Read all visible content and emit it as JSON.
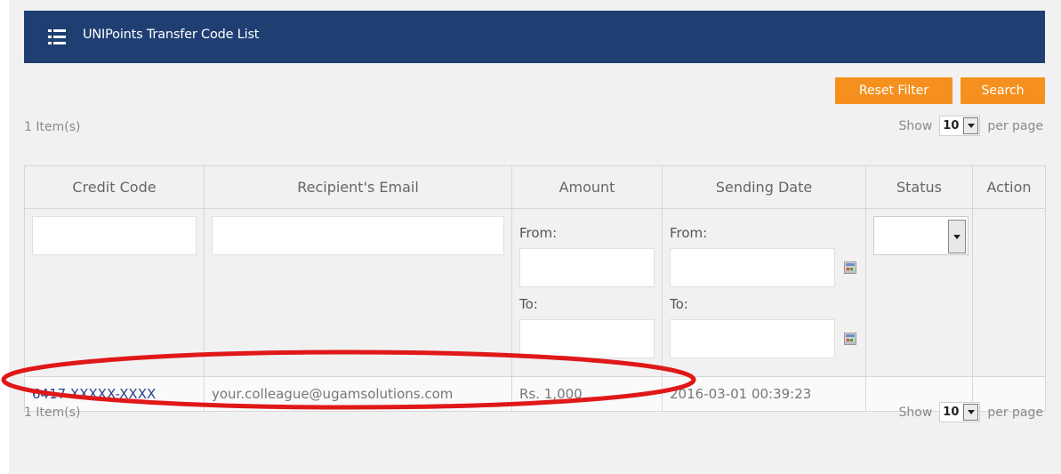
{
  "header": {
    "title": "UNIPoints Transfer Code List",
    "icon": "list-icon"
  },
  "toolbar": {
    "reset_label": "Reset Filter",
    "search_label": "Search",
    "accent": "#f5901e"
  },
  "pagination_top": {
    "count": "1 Item(s)",
    "show": "Show",
    "page_size": "10",
    "per_page": "per page"
  },
  "pagination_bottom": {
    "count": "1 Item(s)",
    "show": "Show",
    "page_size": "10",
    "per_page": "per page"
  },
  "table": {
    "columns": [
      "Credit Code",
      "Recipient's Email",
      "Amount",
      "Sending Date",
      "Status",
      "Action"
    ],
    "filters": {
      "amount_from": "From:",
      "amount_to": "To:",
      "date_from": "From:",
      "date_to": "To:"
    },
    "rows": [
      {
        "credit_code": "6417-XXXXX-XXXX",
        "email": "your.colleague@ugamsolutions.com",
        "amount": "Rs. 1,000",
        "date": "2016-03-01 00:39:23",
        "status": "",
        "action": ""
      }
    ]
  },
  "colors": {
    "header_bg": "#1f3f73",
    "annotation": "#e01818",
    "link": "#2b3f8c"
  }
}
